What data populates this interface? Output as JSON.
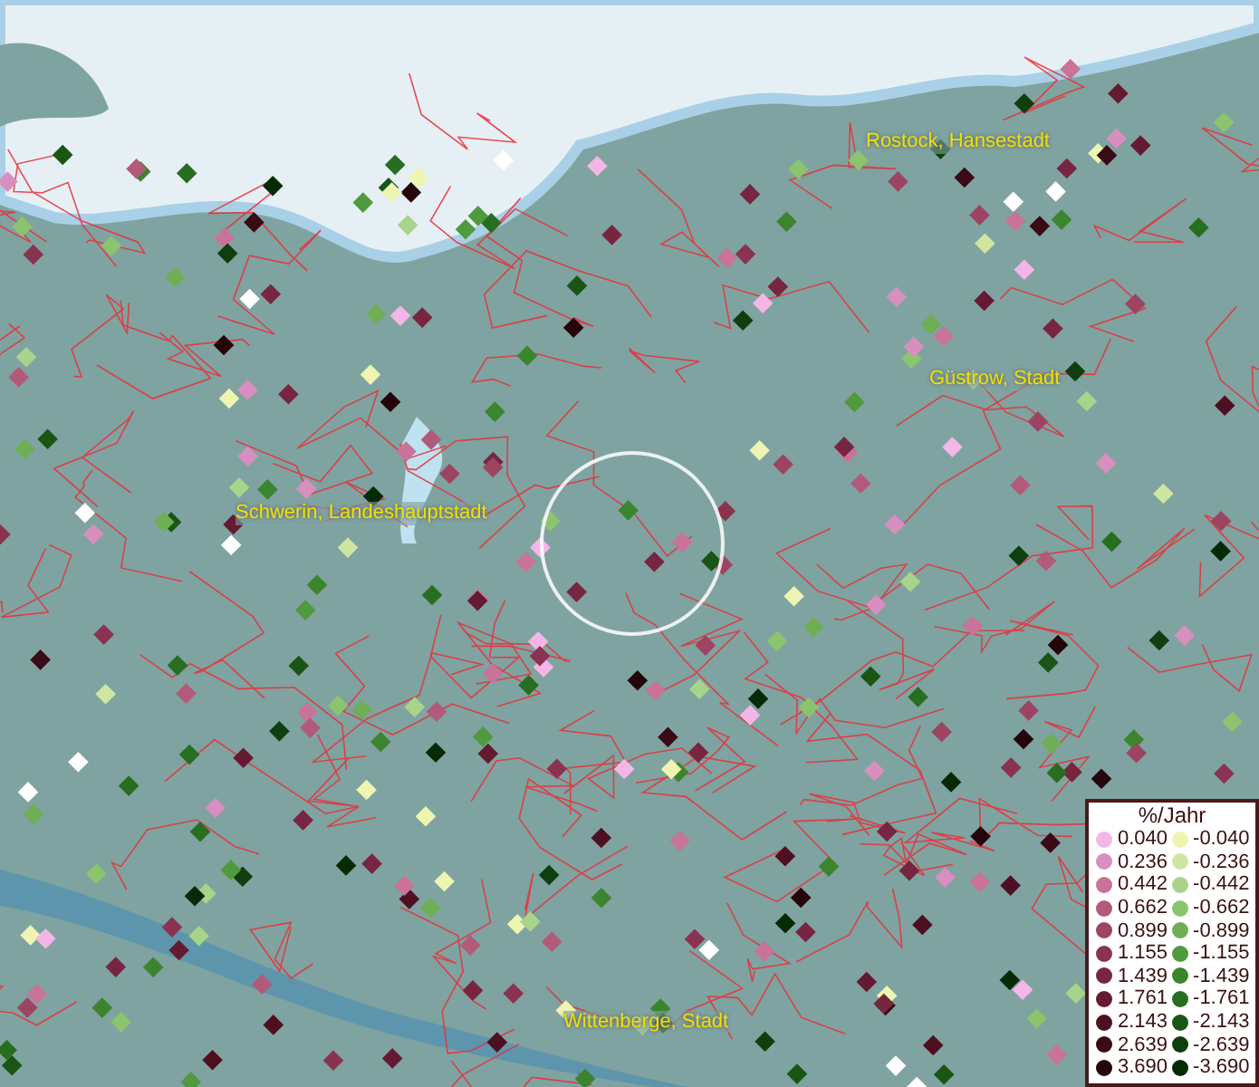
{
  "map": {
    "places": [
      {
        "name": "Rostock, Hansestadt"
      },
      {
        "name": "Güstrow, Stadt"
      },
      {
        "name": "Schwerin, Landeshauptstadt"
      },
      {
        "name": "Wittenberge, Stadt"
      }
    ]
  },
  "legend": {
    "title": "%/Jahr",
    "positive": [
      {
        "label": "0.040",
        "color": "#f4b6e6"
      },
      {
        "label": "0.236",
        "color": "#d98ec0"
      },
      {
        "label": "0.442",
        "color": "#c97399"
      },
      {
        "label": "0.662",
        "color": "#b25a7a"
      },
      {
        "label": "0.899",
        "color": "#9c4462"
      },
      {
        "label": "1.155",
        "color": "#8a3350"
      },
      {
        "label": "1.439",
        "color": "#772540"
      },
      {
        "label": "1.761",
        "color": "#641a30"
      },
      {
        "label": "2.143",
        "color": "#4e1020"
      },
      {
        "label": "2.639",
        "color": "#3a0a15"
      },
      {
        "label": "3.690",
        "color": "#24050a"
      }
    ],
    "negative": [
      {
        "label": "-0.040",
        "color": "#eef5b0"
      },
      {
        "label": "-0.236",
        "color": "#cfe6a0"
      },
      {
        "label": "-0.442",
        "color": "#a8d38a"
      },
      {
        "label": "-0.662",
        "color": "#8cc46e"
      },
      {
        "label": "-0.899",
        "color": "#6fae55"
      },
      {
        "label": "-1.155",
        "color": "#4f9a3e"
      },
      {
        "label": "-1.439",
        "color": "#3a852e"
      },
      {
        "label": "-1.761",
        "color": "#276e20"
      },
      {
        "label": "-2.143",
        "color": "#1a5516"
      },
      {
        "label": "-2.639",
        "color": "#0f3f0e"
      },
      {
        "label": "-3.690",
        "color": "#072a06"
      }
    ]
  }
}
